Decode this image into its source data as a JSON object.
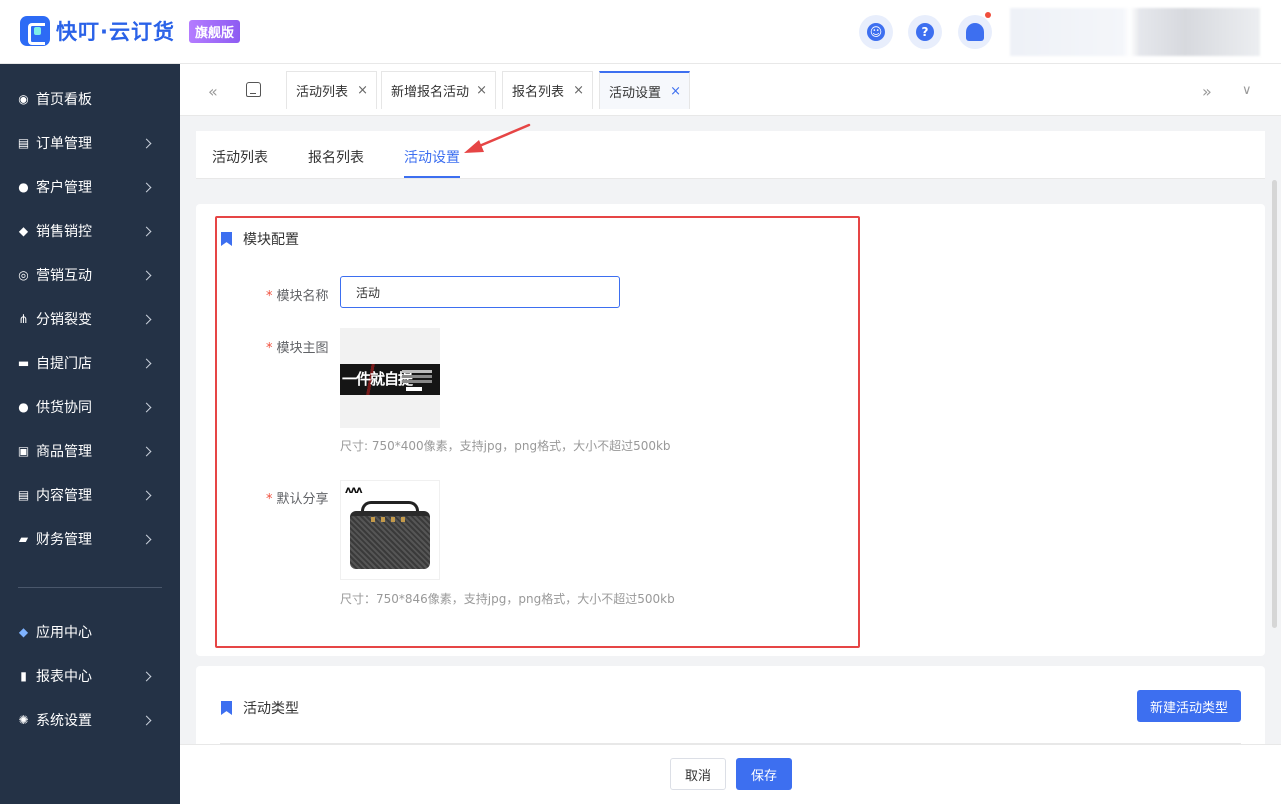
{
  "header": {
    "brand_name": "快叮·云订货",
    "brand_badge": "旗舰版",
    "help_glyph": "?",
    "icons": [
      "service-icon",
      "help-icon",
      "bell-icon"
    ],
    "colors": {
      "brand": "#3d6ff0",
      "sidebar_bg": "#243246",
      "highlight": "#e64545"
    }
  },
  "sidebar": {
    "items": [
      {
        "label": "首页看板",
        "icon": "dashboard-icon",
        "glyph": "◉"
      },
      {
        "label": "订单管理",
        "icon": "order-icon",
        "glyph": "▤"
      },
      {
        "label": "客户管理",
        "icon": "customer-icon",
        "glyph": "●"
      },
      {
        "label": "销售销控",
        "icon": "sales-tag-icon",
        "glyph": "◆"
      },
      {
        "label": "营销互动",
        "icon": "target-icon",
        "glyph": "◎"
      },
      {
        "label": "分销裂变",
        "icon": "hierarchy-icon",
        "glyph": "⋔"
      },
      {
        "label": "自提门店",
        "icon": "store-icon",
        "glyph": "▬"
      },
      {
        "label": "供货协同",
        "icon": "supplier-icon",
        "glyph": "●"
      },
      {
        "label": "商品管理",
        "icon": "goods-icon",
        "glyph": "▣"
      },
      {
        "label": "内容管理",
        "icon": "content-icon",
        "glyph": "▤"
      },
      {
        "label": "财务管理",
        "icon": "wallet-icon",
        "glyph": "▰"
      }
    ],
    "bottom_items": [
      {
        "label": "应用中心",
        "icon": "app-cube-icon",
        "glyph": "◆"
      },
      {
        "label": "报表中心",
        "icon": "report-chart-icon",
        "glyph": "▮"
      },
      {
        "label": "系统设置",
        "icon": "gear-icon",
        "glyph": "✺"
      }
    ]
  },
  "page_tabs": [
    {
      "label": "活动列表"
    },
    {
      "label": "新增报名活动"
    },
    {
      "label": "报名列表"
    },
    {
      "label": "活动设置"
    }
  ],
  "tab_close_glyph": "×",
  "sub_tabs": [
    {
      "label": "活动列表"
    },
    {
      "label": "报名列表"
    },
    {
      "label": "活动设置"
    }
  ],
  "module_config": {
    "title": "模块配置",
    "name_label": "模块名称",
    "name_value": "活动",
    "main_image_label": "模块主图",
    "main_image_banner_text": "一件就自提",
    "main_image_hint": "尺寸: 750*400像素，支持jpg，png格式，大小不超过500kb",
    "share_label": "默认分享",
    "share_image_brand": "ʌʌʌ",
    "share_image_hint": "尺寸：750*846像素，支持jpg，png格式，大小不超过500kb"
  },
  "activity_type": {
    "title": "活动类型",
    "new_button": "新建活动类型"
  },
  "footer": {
    "cancel": "取消",
    "save": "保存"
  }
}
